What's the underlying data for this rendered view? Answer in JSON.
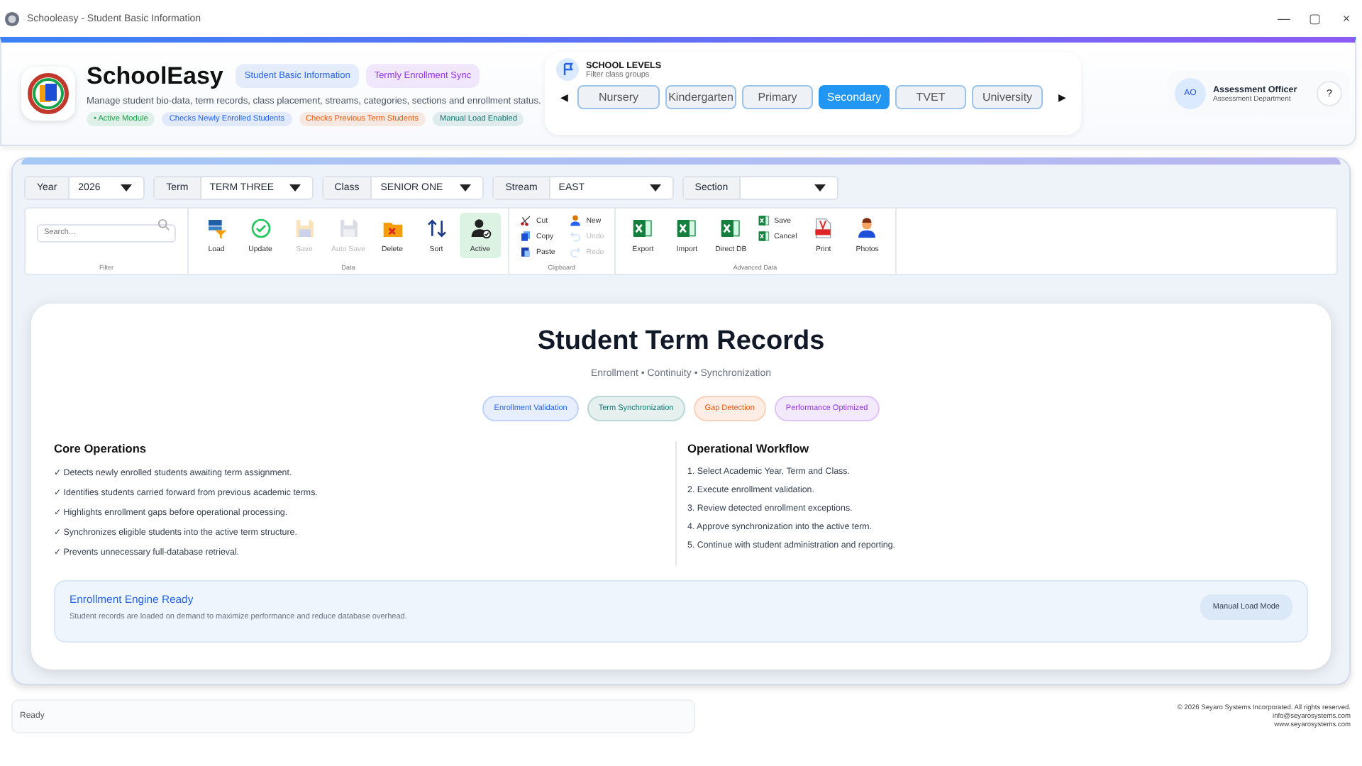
{
  "window": {
    "title": "Schooleasy - Student Basic Information",
    "controls": [
      "—",
      "▢",
      "×"
    ]
  },
  "header": {
    "app_name": "SchoolEasy",
    "badges": [
      {
        "text": "Student Basic Information",
        "color": "#2563eb"
      },
      {
        "text": "Termly Enrollment Sync",
        "color": "#9333ea"
      }
    ],
    "description": "Manage student bio-data, term records, class placement, streams, categories, sections and enrollment status.",
    "chips": [
      {
        "text": "• Active Module",
        "color": "#16a34a"
      },
      {
        "text": "Checks Newly Enrolled Students",
        "color": "#2563eb"
      },
      {
        "text": "Checks Previous Term Students",
        "color": "#ea580c"
      },
      {
        "text": "Manual Load Enabled",
        "color": "#0f766e"
      }
    ]
  },
  "school_levels": {
    "title": "SCHOOL LEVELS",
    "subtitle": "Filter class groups",
    "prev": "◀",
    "next": "▶",
    "levels": [
      {
        "label": "Nursery",
        "selected": false
      },
      {
        "label": "Kindergarten",
        "selected": false
      },
      {
        "label": "Primary",
        "selected": false
      },
      {
        "label": "Secondary",
        "selected": true
      },
      {
        "label": "TVET",
        "selected": false
      },
      {
        "label": "University",
        "selected": false
      }
    ]
  },
  "user": {
    "initials": "AO",
    "name": "Assessment Officer",
    "department": "Assessment Department",
    "help": "?"
  },
  "filters": [
    {
      "label": "Year",
      "value": "2026"
    },
    {
      "label": "Term",
      "value": "TERM THREE"
    },
    {
      "label": "Class",
      "value": "SENIOR ONE"
    },
    {
      "label": "Stream",
      "value": "EAST"
    },
    {
      "label": "Section"
    }
  ],
  "ribbon": {
    "search": {
      "placeholder": "Search..."
    },
    "filter_label": "Filter",
    "groups": [
      {
        "label": "Data",
        "kind": "large",
        "buttons": [
          {
            "label": "Load",
            "disabled": false,
            "on": false
          },
          {
            "label": "Update",
            "disabled": false,
            "on": false
          },
          {
            "label": "Save",
            "disabled": true,
            "on": false
          },
          {
            "label": "Auto Save",
            "disabled": true,
            "on": false
          },
          {
            "label": "Delete",
            "disabled": false,
            "on": false
          },
          {
            "label": "Sort",
            "disabled": false,
            "on": false
          },
          {
            "label": "Active",
            "disabled": false,
            "on": true
          }
        ]
      },
      {
        "label": "Clipboard",
        "kind": "small",
        "buttons": [
          {
            "label": "Cut",
            "disabled": false,
            "on": false
          },
          {
            "label": "Copy",
            "disabled": false,
            "on": false
          },
          {
            "label": "Paste",
            "disabled": false,
            "on": false
          },
          {
            "label": "New",
            "disabled": false,
            "on": false
          },
          {
            "label": "Undo",
            "disabled": true,
            "on": false
          },
          {
            "label": "Redo",
            "disabled": true,
            "on": false
          }
        ]
      },
      {
        "label": "Advanced Data",
        "kind": "mixed",
        "buttons": [
          {
            "label": "Export",
            "disabled": false,
            "on": false
          },
          {
            "label": "Import",
            "disabled": false,
            "on": false
          },
          {
            "label": "Direct DB",
            "disabled": false,
            "on": false
          },
          {
            "label": "Save",
            "disabled": false,
            "on": false
          },
          {
            "label": "Cancel",
            "disabled": false,
            "on": false
          },
          {
            "label": "Print",
            "disabled": false,
            "on": false
          },
          {
            "label": "Photos",
            "disabled": false,
            "on": false
          }
        ]
      }
    ]
  },
  "records": {
    "title": "Student Term Records",
    "subtitle": "Enrollment • Continuity • Synchronization",
    "tags": [
      {
        "text": "Enrollment Validation",
        "color": "#2563eb"
      },
      {
        "text": "Term Synchronization",
        "color": "#0f766e"
      },
      {
        "text": "Gap Detection",
        "color": "#ea580c"
      },
      {
        "text": "Performance Optimized",
        "color": "#9333ea"
      }
    ],
    "core_operations": {
      "title": "Core Operations",
      "items": [
        "✓ Detects newly enrolled students awaiting term assignment.",
        "✓ Identifies students carried forward from previous academic terms.",
        "✓ Highlights enrollment gaps before operational processing.",
        "✓ Synchronizes eligible students into the active term structure.",
        "✓ Prevents unnecessary full-database retrieval."
      ]
    },
    "workflow": {
      "title": "Operational Workflow",
      "items": [
        "1. Select Academic Year, Term and Class.",
        "2. Execute enrollment validation.",
        "3. Review detected enrollment exceptions.",
        "4. Approve synchronization into the active term.",
        "5. Continue with student administration and reporting."
      ]
    },
    "banner": {
      "title": "Enrollment Engine Ready",
      "text": "Student records are loaded on demand to maximize performance and reduce database overhead.",
      "button": "Manual Load Mode"
    }
  },
  "status_bar": {
    "status": "Ready",
    "footer_lines": [
      "© 2026 Seyaro Systems Incorporated. All rights reserved.",
      "info@seyarosystems.com",
      "www.seyarosystems.com"
    ]
  }
}
